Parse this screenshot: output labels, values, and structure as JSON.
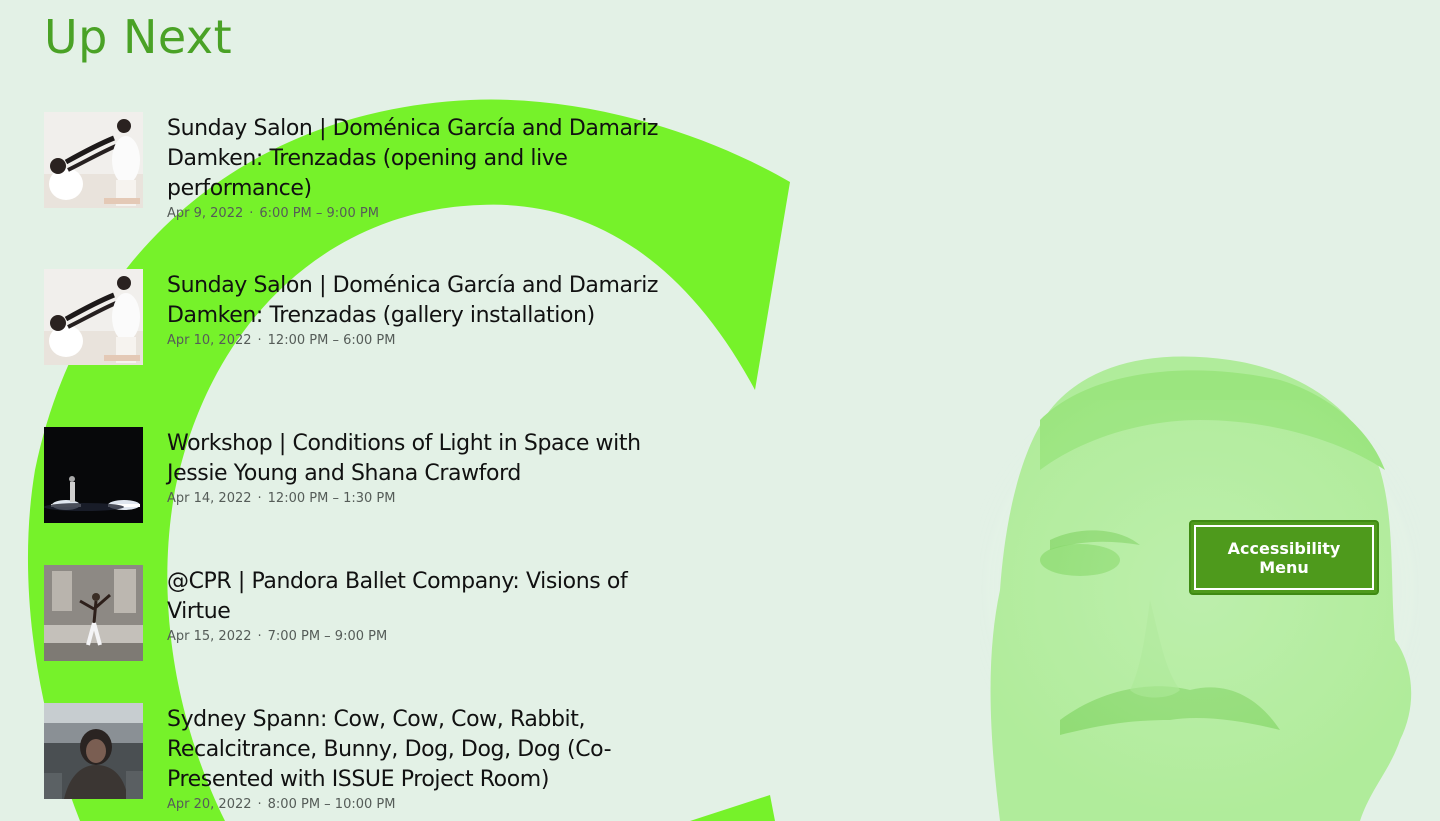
{
  "page": {
    "title": "Up Next"
  },
  "events": [
    {
      "title": "Sunday Salon | Doménica García and Damariz Damken: Trenzadas (opening and live performance)",
      "date": "Apr 9, 2022",
      "separator": "·",
      "time": "6:00 PM – 9:00 PM",
      "thumbnail": "dancers-braid-photo"
    },
    {
      "title": "Sunday Salon | Doménica García and Damariz Damken: Trenzadas (gallery installation)",
      "date": "Apr 10, 2022",
      "separator": "·",
      "time": "12:00 PM – 6:00 PM",
      "thumbnail": "dancers-braid-photo"
    },
    {
      "title": "Workshop | Conditions of Light in Space with Jessie Young and Shana Crawford",
      "date": "Apr 14, 2022",
      "separator": "·",
      "time": "12:00 PM – 1:30 PM",
      "thumbnail": "dark-stage-light-photo"
    },
    {
      "title": "@CPR | Pandora Ballet Company: Visions of Virtue",
      "date": "Apr 15, 2022",
      "separator": "·",
      "time": "7:00 PM – 9:00 PM",
      "thumbnail": "ballet-fountain-photo"
    },
    {
      "title": "Sydney Spann: Cow, Cow, Cow, Rabbit, Recalcitrance, Bunny, Dog, Dog, Dog (Co-Presented with ISSUE Project Room)",
      "date": "Apr 20, 2022",
      "separator": "·",
      "time": "8:00 PM – 10:00 PM",
      "thumbnail": "rooftop-portrait-photo"
    }
  ],
  "accessibility": {
    "label": "Accessibility Menu"
  },
  "colors": {
    "background": "#e3f1e6",
    "accent_green": "#76f22a",
    "title_green": "#4aa226",
    "button_green": "#4e9a1c",
    "portrait_tint": "#86e060"
  }
}
